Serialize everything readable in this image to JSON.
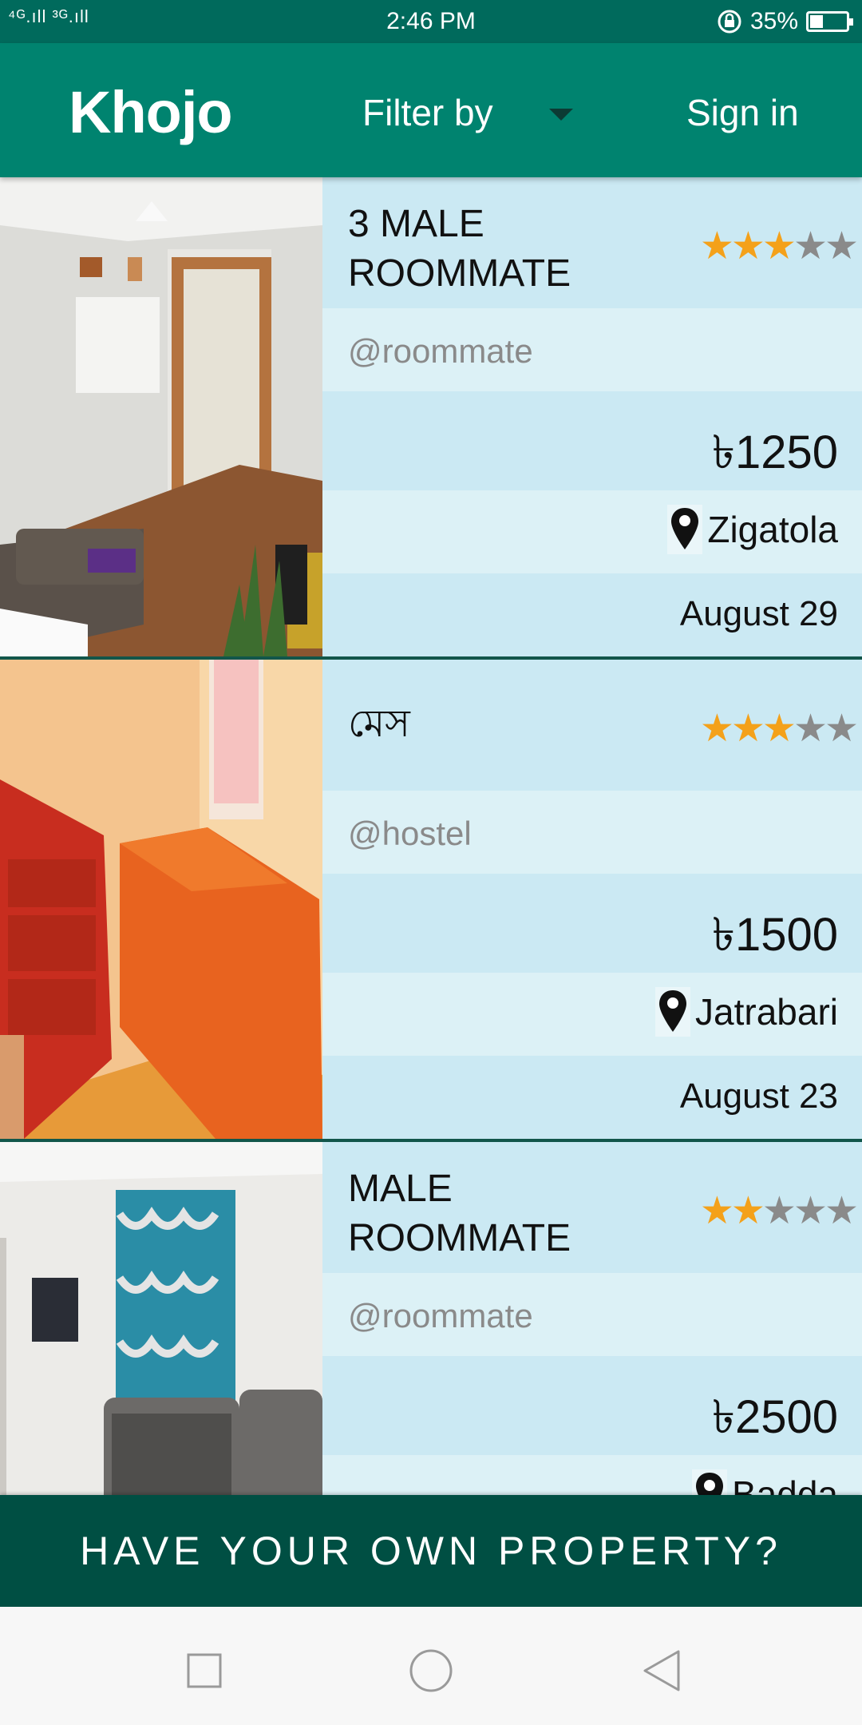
{
  "status_bar": {
    "signal": "⁴ᴳ.ıll ³ᴳ.ıll",
    "time": "2:46 PM",
    "battery": "35%"
  },
  "toolbar": {
    "brand": "Khojo",
    "filter_label": "Filter by",
    "signin_label": "Sign in"
  },
  "listings": [
    {
      "title": "3 MALE ROOMMATE",
      "rating": 3,
      "stars": [
        "★",
        "★",
        "★",
        "★",
        "★"
      ],
      "handle": "@roommate",
      "price": "৳1250",
      "location": "Zigatola",
      "date": "August 29"
    },
    {
      "title": "মেস",
      "rating": 3,
      "stars": [
        "★",
        "★",
        "★",
        "★",
        "★"
      ],
      "handle": "@hostel",
      "price": "৳1500",
      "location": "Jatrabari",
      "date": "August 23"
    },
    {
      "title": "MALE ROOMMATE",
      "rating": 2,
      "stars": [
        "★",
        "★",
        "★",
        "★",
        "★"
      ],
      "handle": "@roommate",
      "price": "৳2500",
      "location": "Badda",
      "date": ""
    }
  ],
  "banner_label": "HAVE YOUR OWN PROPERTY?",
  "colors": {
    "toolbar": "#00836f",
    "status_bar": "#006a5c",
    "banner": "#004f43",
    "card_band_dark": "#cbe9f3",
    "card_band_light": "#dcf1f6",
    "star_on": "#f4a11a",
    "star_off": "#8a8a8a"
  }
}
